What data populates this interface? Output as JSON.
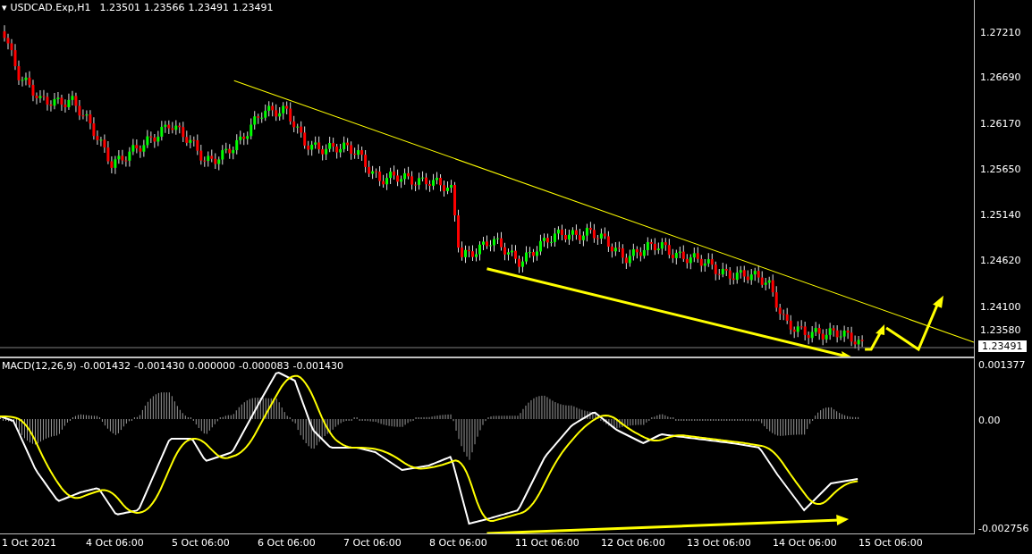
{
  "main_chart": {
    "menu_glyph": "▾",
    "symbol_line": "USDCAD.Exp,H1",
    "ohlc": [
      "1.23501",
      "1.23566",
      "1.23491",
      "1.23491"
    ]
  },
  "price_axis": {
    "ticks": [
      "1.27210",
      "1.26690",
      "1.26170",
      "1.25650",
      "1.25140",
      "1.24620",
      "1.24100",
      "1.23580"
    ],
    "current_price": "1.23491"
  },
  "macd_panel": {
    "title": "MACD(12,26,9)",
    "values": [
      "-0.001432",
      "-0.001430",
      "0.000000",
      "-0.000083",
      "-0.001430"
    ]
  },
  "macd_axis": {
    "ticks": [
      "0.001377",
      "0.00",
      "-0.002756"
    ]
  },
  "time_axis": {
    "labels": [
      "1 Oct 2021",
      "4 Oct 06:00",
      "5 Oct 06:00",
      "6 Oct 06:00",
      "7 Oct 06:00",
      "8 Oct 06:00",
      "11 Oct 06:00",
      "12 Oct 06:00",
      "13 Oct 06:00",
      "14 Oct 06:00",
      "15 Oct 06:00"
    ]
  }
}
